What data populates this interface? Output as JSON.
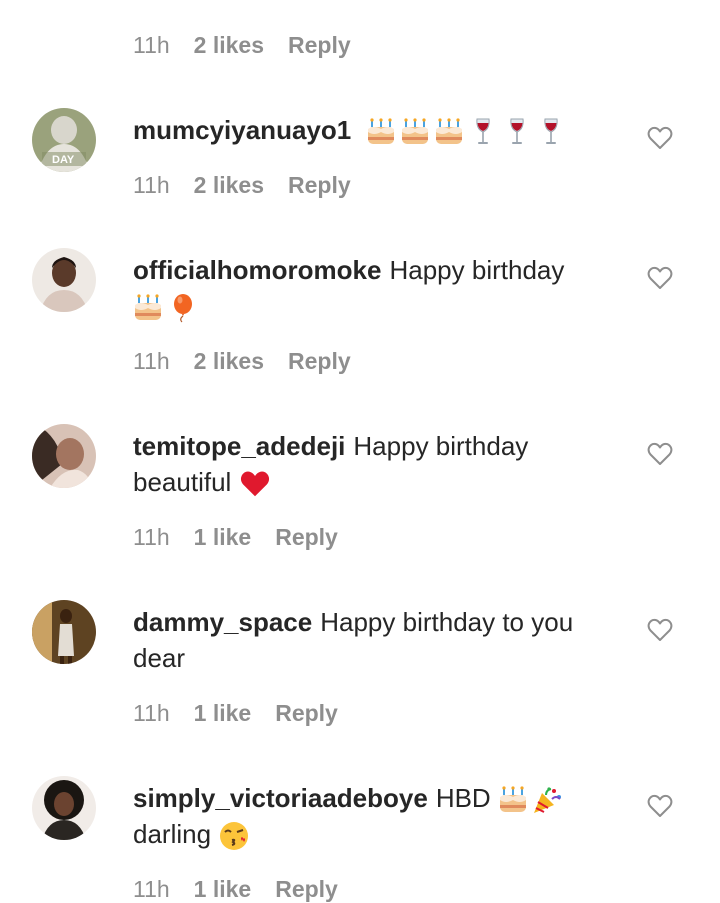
{
  "top_meta": {
    "time": "11h",
    "likes": "2 likes",
    "reply": "Reply"
  },
  "comments": [
    {
      "username": "mumcyiyanuayo1",
      "text": "",
      "emojis": [
        "birthday-cake",
        "birthday-cake",
        "birthday-cake",
        "wine-glass",
        "wine-glass",
        "wine-glass"
      ],
      "time": "11h",
      "likes": "2 likes",
      "reply": "Reply",
      "avatar_text": "DAY"
    },
    {
      "username": "officialhomoromoke",
      "text": "Happy birthday",
      "emojis": [
        "birthday-cake",
        "balloon"
      ],
      "time": "11h",
      "likes": "2 likes",
      "reply": "Reply"
    },
    {
      "username": "temitope_adedeji",
      "text": "Happy birthday beautiful",
      "emojis": [
        "red-heart"
      ],
      "time": "11h",
      "likes": "1 like",
      "reply": "Reply"
    },
    {
      "username": "dammy_space",
      "text": "Happy birthday to you dear",
      "emojis": [],
      "time": "11h",
      "likes": "1 like",
      "reply": "Reply"
    },
    {
      "username": "simply_victoriaadeboye",
      "text": "HBD",
      "text_after": "darling",
      "emojis": [
        "birthday-cake",
        "party-popper"
      ],
      "emojis_after": [
        "kissing-face"
      ],
      "time": "11h",
      "likes": "1 like",
      "reply": "Reply"
    }
  ],
  "colors": {
    "text": "#262626",
    "meta": "#8e8e8e",
    "heart_outline": "#8e8e8e",
    "heart_red": "#e0192e"
  }
}
